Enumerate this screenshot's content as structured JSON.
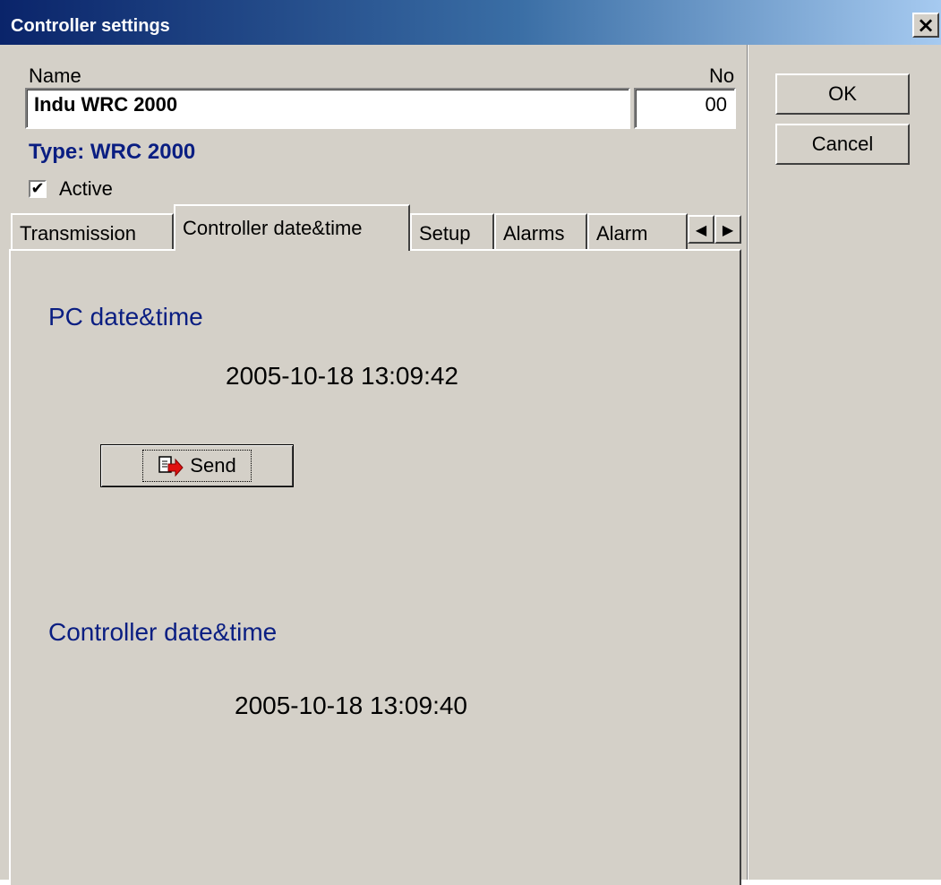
{
  "window": {
    "title": "Controller settings",
    "close_label": "×"
  },
  "form": {
    "name_label": "Name",
    "no_label": "No",
    "name_value": "Indu WRC 2000",
    "no_value": "00",
    "type_label": "Type: WRC 2000",
    "active_label": "Active",
    "active_checked": true,
    "check_mark": "✔"
  },
  "tabs": [
    {
      "label": "Transmission",
      "selected": false
    },
    {
      "label": "Controller date&time",
      "selected": true
    },
    {
      "label": "Setup",
      "selected": false
    },
    {
      "label": "Alarms",
      "selected": false
    },
    {
      "label": "Alarm",
      "selected": false
    }
  ],
  "tab_scroll": {
    "left": "◀",
    "right": "▶"
  },
  "panel": {
    "pc_heading": "PC date&time",
    "pc_datetime": "2005-10-18 13:09:42",
    "send_label": "Send",
    "controller_heading": "Controller date&time",
    "controller_datetime": "2005-10-18 13:09:40"
  },
  "buttons": {
    "ok": "OK",
    "cancel": "Cancel"
  }
}
